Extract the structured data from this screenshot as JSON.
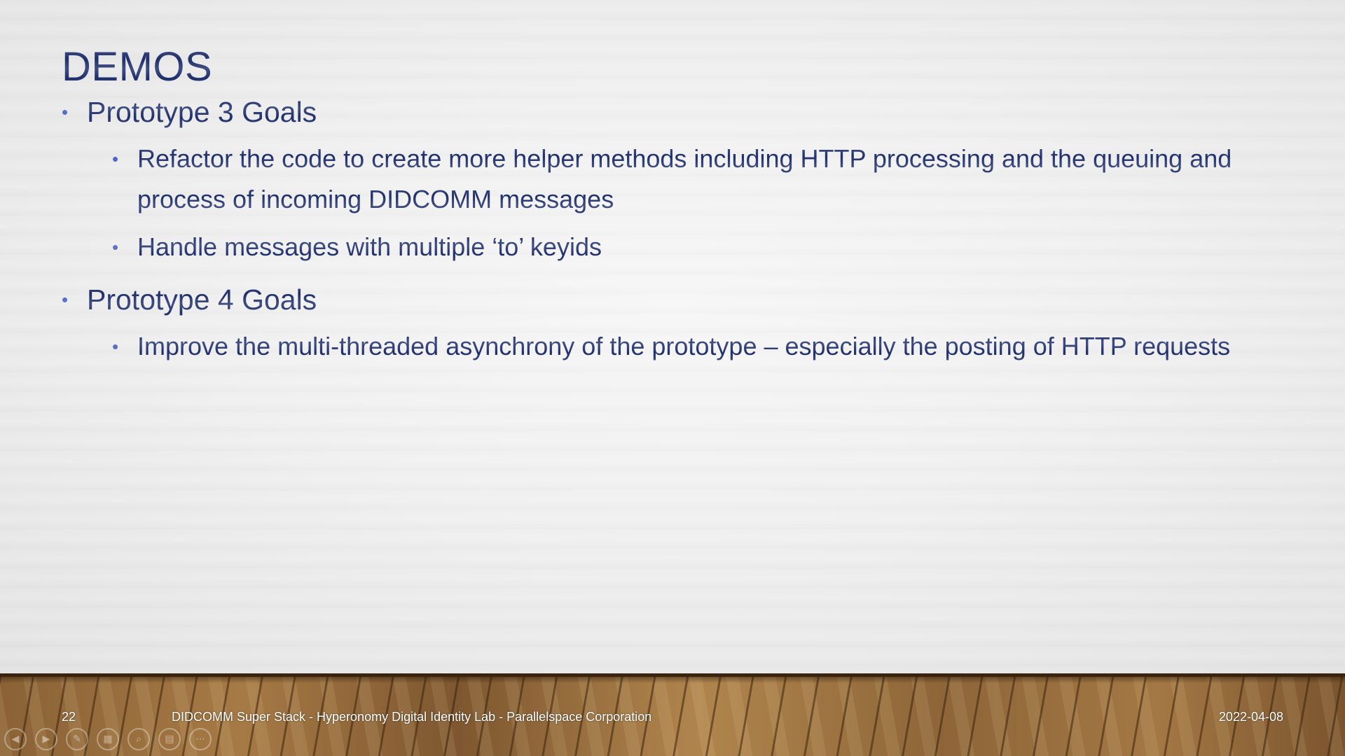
{
  "slide": {
    "title": "DEMOS",
    "bullets": [
      {
        "text": "Prototype 3 Goals",
        "sub": [
          "Refactor the code to create more helper methods including HTTP processing and the queuing and process of incoming DIDCOMM messages",
          "Handle messages with multiple ‘to’ keyids"
        ]
      },
      {
        "text": "Prototype 4 Goals",
        "sub": [
          "Improve the multi-threaded asynchrony of the prototype – especially the posting of HTTP requests"
        ]
      }
    ],
    "bullet_glyph": "•"
  },
  "footer": {
    "page_number": "22",
    "text": "DIDCOMM Super Stack - Hyperonomy Digital Identity Lab - Parallelspace Corporation",
    "date": "2022-04-08"
  },
  "controls": [
    {
      "name": "previous-icon",
      "glyph": "◀"
    },
    {
      "name": "next-icon",
      "glyph": "▶"
    },
    {
      "name": "pen-icon",
      "glyph": "✎"
    },
    {
      "name": "slides-grid-icon",
      "glyph": "▦"
    },
    {
      "name": "zoom-icon",
      "glyph": "⌕"
    },
    {
      "name": "subtitles-icon",
      "glyph": "▤"
    },
    {
      "name": "more-options-icon",
      "glyph": "⋯"
    }
  ],
  "colors": {
    "text": "#1f2f6b",
    "bullet": "#4a63c4",
    "footer_text": "#ffffff"
  }
}
